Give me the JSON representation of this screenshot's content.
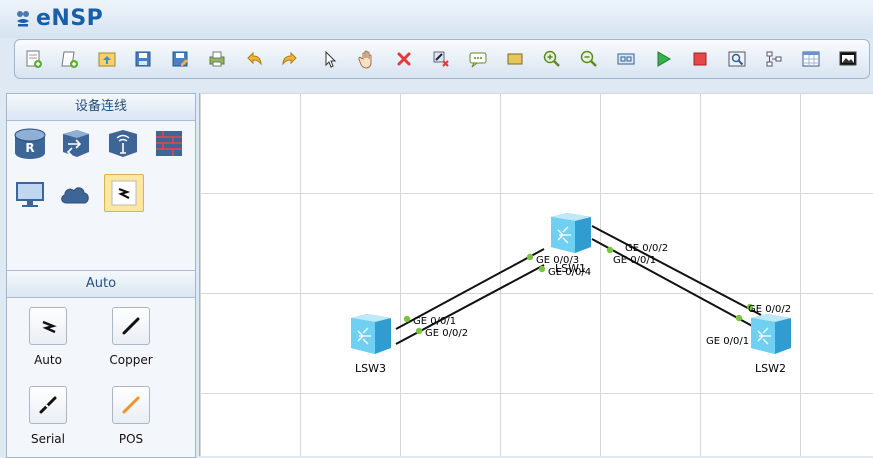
{
  "app": {
    "title": "eNSP"
  },
  "toolbar": {
    "buttons": [
      {
        "name": "new-topology-icon"
      },
      {
        "name": "new-page-icon"
      },
      {
        "name": "open-icon"
      },
      {
        "name": "save-icon"
      },
      {
        "name": "save-as-icon"
      },
      {
        "name": "print-icon"
      },
      {
        "name": "undo-icon"
      },
      {
        "name": "redo-icon"
      },
      {
        "name": "select-pointer-icon"
      },
      {
        "name": "pan-hand-icon"
      },
      {
        "name": "delete-icon"
      },
      {
        "name": "delete-link-icon"
      },
      {
        "name": "text-note-icon"
      },
      {
        "name": "rectangle-icon"
      },
      {
        "name": "zoom-in-icon"
      },
      {
        "name": "zoom-out-icon"
      },
      {
        "name": "interface-icon"
      },
      {
        "name": "start-icon"
      },
      {
        "name": "stop-icon"
      },
      {
        "name": "capture-icon"
      },
      {
        "name": "topology-icon"
      },
      {
        "name": "grid-icon"
      },
      {
        "name": "screen-icon"
      }
    ]
  },
  "left_panel": {
    "device_section_title": "设备连线",
    "device_icons": [
      "router-icon",
      "switch-icon",
      "wireless-icon",
      "firewall-icon",
      "pc-icon",
      "cloud-icon",
      "link-icon"
    ],
    "auto_section_title": "Auto",
    "cables": [
      {
        "label": "Auto"
      },
      {
        "label": "Copper"
      },
      {
        "label": "Serial"
      },
      {
        "label": "POS"
      }
    ]
  },
  "topology": {
    "devices": [
      {
        "id": "LSW1",
        "label": "LSW1"
      },
      {
        "id": "LSW2",
        "label": "LSW2"
      },
      {
        "id": "LSW3",
        "label": "LSW3"
      }
    ],
    "ports": {
      "lsw3_a": "GE 0/0/1",
      "lsw3_b": "GE 0/0/2",
      "lsw1_a": "GE 0/0/3",
      "lsw1_b": "GE 0/0/4",
      "lsw1_c": "GE 0/0/2",
      "lsw1_d": "GE 0/0/1",
      "lsw2_a": "GE 0/0/2",
      "lsw2_b": "GE 0/0/1"
    },
    "colors": {
      "link": "#111111",
      "port_dot": "#7cc242",
      "switch": "#5fc4ea"
    }
  }
}
